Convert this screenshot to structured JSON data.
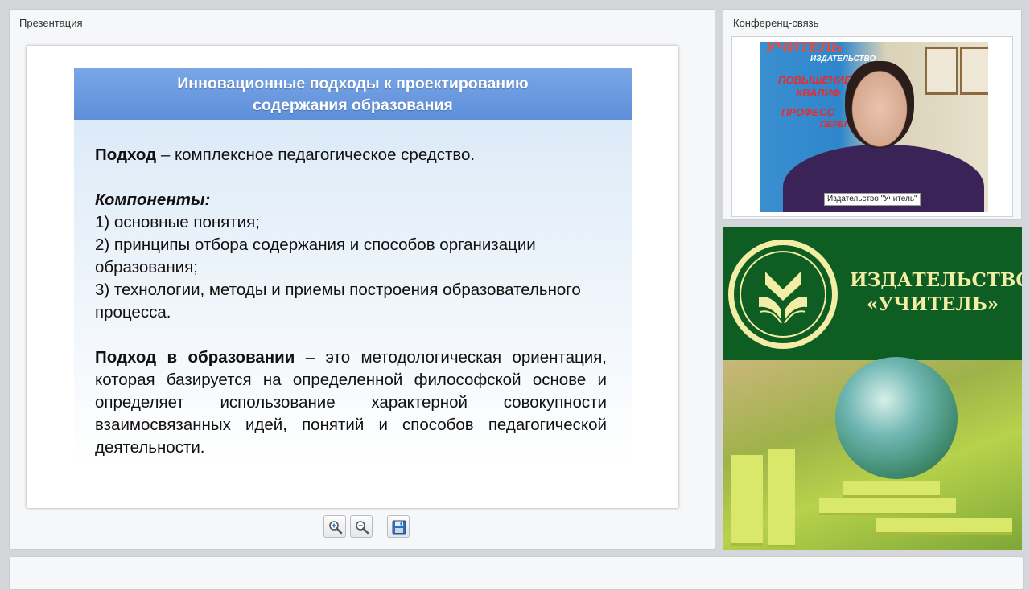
{
  "presentation_panel": {
    "title": "Презентация",
    "slide": {
      "heading_line1": "Инновационные подходы к проектированию",
      "heading_line2": "содержания образования",
      "p1_bold": "Подход",
      "p1_rest": " – комплексное педагогическое средство.",
      "components_label": "Компоненты:",
      "items": [
        "1) основные понятия;",
        "2) принципы отбора содержания и способов организации образования;",
        "3) технологии, методы и приемы построения образовательного процесса."
      ],
      "p3_bold": "Подход в образовании",
      "p3_rest": " – это методологическая ориентация, которая базируется на определенной философской основе и определяет использование характерной совокупности взаимосвязанных идей, понятий и способов педагогической деятельности."
    },
    "toolbar": {
      "zoom_in_icon": "zoom-in-icon",
      "zoom_out_icon": "zoom-out-icon",
      "save_icon": "floppy-disk-icon"
    }
  },
  "conference_panel": {
    "title": "Конференц-связь",
    "video_label": "Издательство \"Учитель\"",
    "banner_lines": [
      "УЧИТЕЛЬ",
      "ИЗДАТЕЛЬСТВО",
      "ПОВЫШЕНИЕ",
      "КВАЛИФ",
      "ПРОФЕСС",
      "ПЕРЕПО"
    ]
  },
  "ad_panel": {
    "title_line1": "ИЗДАТЕЛЬСТВО",
    "title_line2": "«УЧИТЕЛЬ»"
  },
  "colors": {
    "slide_header": "#5e8fda",
    "ad_green": "#0e5e23",
    "ad_cream": "#f3eda6"
  }
}
